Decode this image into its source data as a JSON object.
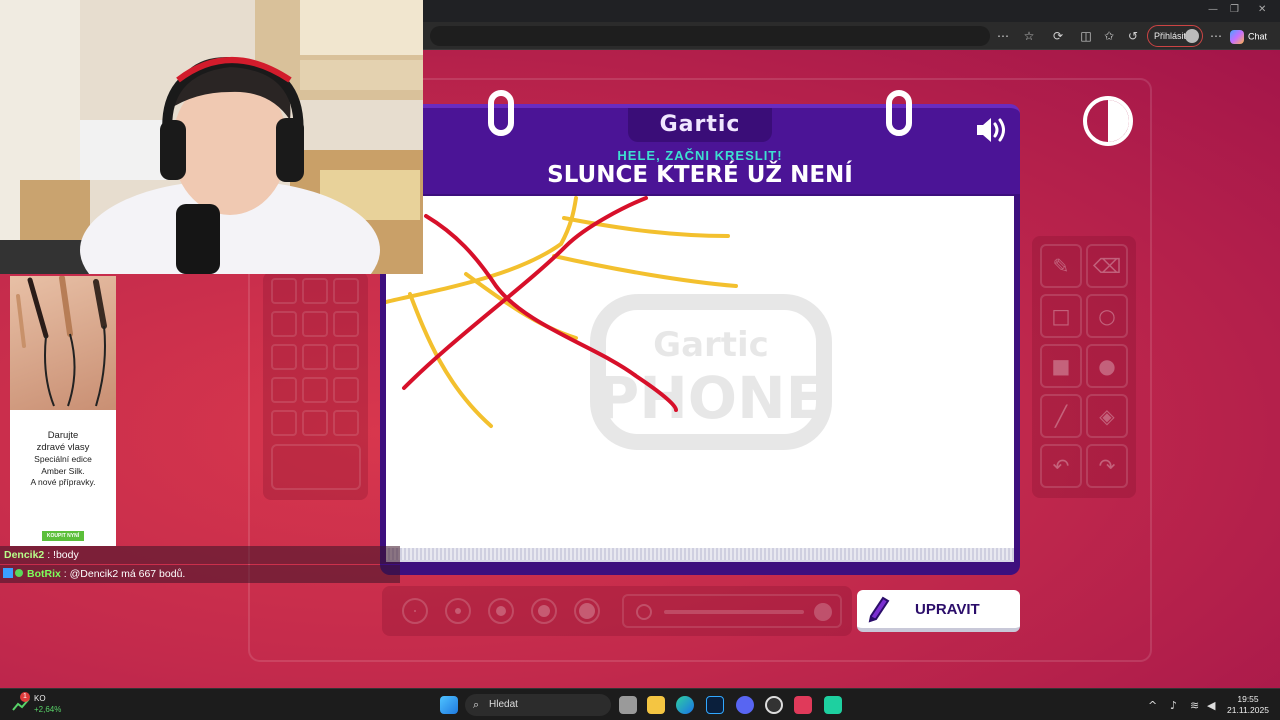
{
  "browser": {
    "signin_label": "Přihlásit",
    "chat_label": "Chat"
  },
  "game": {
    "logo": "Gartic",
    "subtitle": "HELE, ZAČNI KRESLIT!",
    "prompt": "SLUNCE KTERÉ UŽ NENÍ",
    "edit_button": "UPRAVIT",
    "watermark_top": "Gartic",
    "watermark_bottom": "PHONE",
    "colors": {
      "purple": "#4b1496",
      "red_stroke": "#d7102a",
      "yellow_stroke": "#f3c02e"
    }
  },
  "ad": {
    "headline_1": "Darujte",
    "headline_2": "zdravé vlasy",
    "line_1": "Speciální edice",
    "line_2": "Amber Silk.",
    "line_3": "A nové přípravky.",
    "cta": "KOUPIT NYNÍ"
  },
  "chat": [
    {
      "user": "Dencik2",
      "sep": " : ",
      "message": "!body"
    },
    {
      "user": "BotRix",
      "sep": " : ",
      "message": "@Dencik2 má 667 bodů."
    }
  ],
  "taskbar": {
    "search_placeholder": "Hledat",
    "stock_name": "KO",
    "stock_change": "+2,64%",
    "stock_badge": "1",
    "time": "19:55",
    "date": "21.11.2025"
  }
}
